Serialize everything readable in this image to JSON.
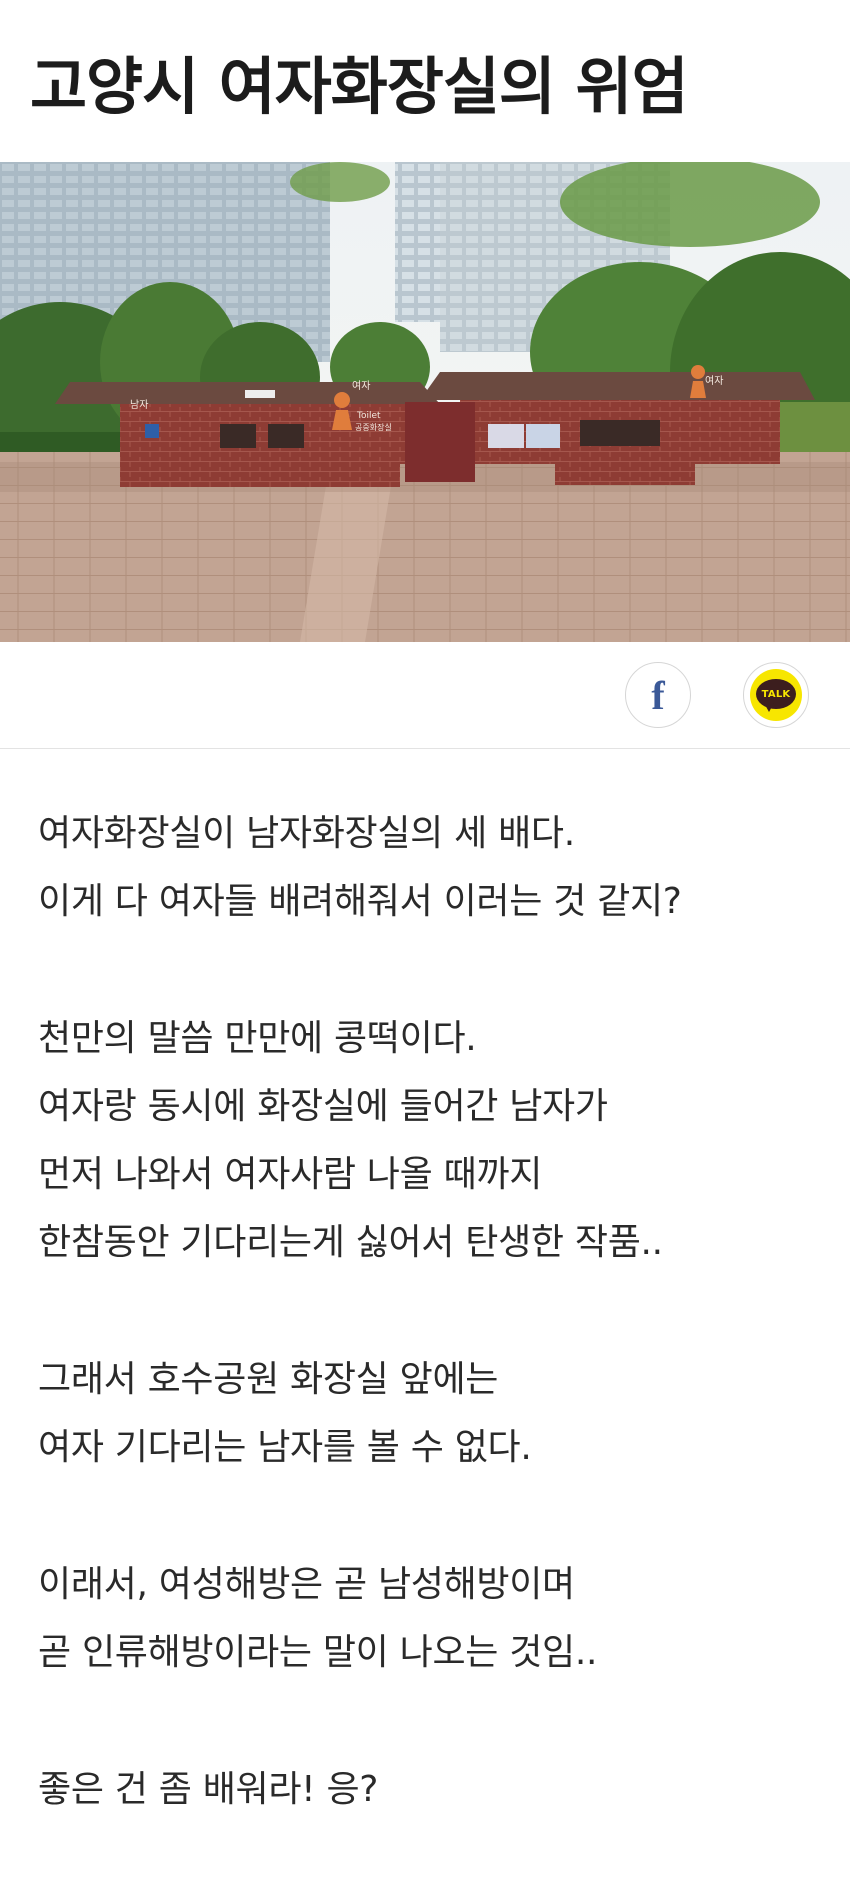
{
  "article": {
    "title": "고양시 여자화장실의 위엄"
  },
  "photo": {
    "sign_left_men": "남자",
    "sign_left_women": "여자",
    "sign_toilet": "Toilet",
    "sign_toilet_sub": "공중화장실",
    "sign_right_women": "여자"
  },
  "share": {
    "facebook_icon": "f",
    "kakao_label": "TALK"
  },
  "body": {
    "paragraphs": [
      {
        "lines": [
          "여자화장실이 남자화장실의 세 배다.",
          "이게 다 여자들 배려해줘서 이러는 것 같지?"
        ]
      },
      {
        "lines": [
          "천만의 말씀 만만에 콩떡이다.",
          "여자랑 동시에 화장실에 들어간 남자가",
          "먼저 나와서 여자사람 나올 때까지",
          "한참동안 기다리는게 싫어서 탄생한 작품.."
        ]
      },
      {
        "lines": [
          "그래서 호수공원 화장실 앞에는",
          "여자 기다리는 남자를 볼 수 없다."
        ]
      },
      {
        "lines": [
          "이래서, 여성해방은 곧 남성해방이며",
          "곧 인류해방이라는 말이 나오는 것임.."
        ]
      },
      {
        "lines": [
          "좋은 건 좀 배워라! 응?"
        ]
      }
    ]
  },
  "colors": {
    "brick": "#8a3a33",
    "roof": "#5e4038",
    "women_sign": "#e07d3c",
    "facebook": "#3b5998",
    "kakao_yellow": "#f7e600"
  }
}
